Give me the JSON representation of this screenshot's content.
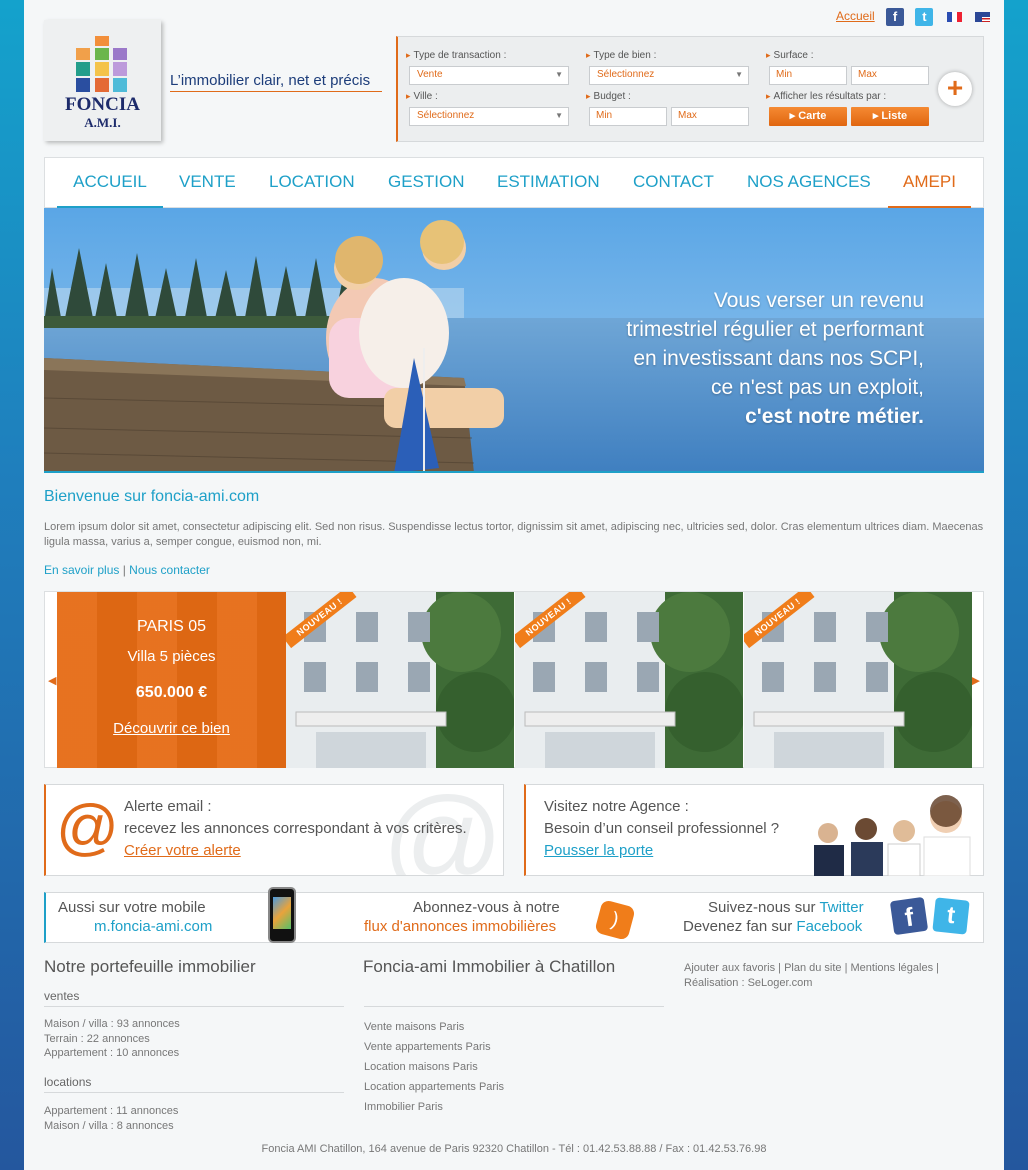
{
  "top": {
    "home_link": "Accueil",
    "fb_letter": "f",
    "tw_letter": "t"
  },
  "logo": {
    "line1": "FONCIA",
    "line2": "A.M.I."
  },
  "tagline": "L’immobilier clair, net et précis",
  "search": {
    "transaction_label": "Type de transaction :",
    "transaction_value": "Vente",
    "bien_label": "Type de bien :",
    "bien_value": "Sélectionnez",
    "surface_label": "Surface :",
    "surface_min": "Min",
    "surface_max": "Max",
    "ville_label": "Ville :",
    "ville_value": "Sélectionnez",
    "budget_label": "Budget :",
    "budget_min": "Min",
    "budget_max": "Max",
    "results_label": "Afficher les résultats par :",
    "carte_btn": "▸ Carte",
    "liste_btn": "▸ Liste",
    "plus": "+"
  },
  "nav": [
    "ACCUEIL",
    "VENTE",
    "LOCATION",
    "GESTION",
    "ESTIMATION",
    "CONTACT",
    "NOS AGENCES",
    "AMEPI"
  ],
  "hero": {
    "l1": "Vous verser un revenu",
    "l2": "trimestriel régulier et performant",
    "l3": "en investissant dans nos SCPI,",
    "l4": "ce n'est pas un exploit,",
    "l5": "c'est notre métier."
  },
  "welcome": {
    "title": "Bienvenue sur foncia-ami.com",
    "text": "Lorem ipsum dolor sit amet, consectetur adipiscing elit. Sed non risus. Suspendisse lectus tortor, dignissim sit amet, adipiscing nec, ultricies sed, dolor. Cras elementum ultrices diam. Maecenas ligula massa, varius a, semper congue, euismod non, mi.",
    "link1": "En savoir plus",
    "sep": " | ",
    "link2": "Nous contacter"
  },
  "featured": {
    "city": "PARIS 05",
    "type": "Villa 5 pièces",
    "price": "650.000 €",
    "cta": "Découvrir ce bien",
    "badge": "NOUVEAU !"
  },
  "alert": {
    "l1": "Alerte email :",
    "l2": "recevez les annonces correspondant à vos critères.",
    "cta": "Créer votre alerte",
    "at": "@"
  },
  "agence": {
    "l1": "Visitez notre Agence :",
    "l2": "Besoin d’un conseil professionnel ?",
    "cta": "Pousser la porte"
  },
  "strip": {
    "mobile1": "Aussi sur votre  mobile",
    "mobile2": "m.foncia-ami.com",
    "flux1": "Abonnez-vous à notre",
    "flux2": "flux d'annonces immobilières",
    "tw_pre": "Suivez-nous sur ",
    "tw_link": "Twitter",
    "fb_pre": "Devenez fan sur ",
    "fb_link": "Facebook"
  },
  "footer": {
    "col1_title": "Notre portefeuille immobilier",
    "ventes": "ventes",
    "v1": "Maison / villa : 93 annonces",
    "v2": "Terrain : 22 annonces",
    "v3": "Appartement : 10 annonces",
    "locations": "locations",
    "lo1": "Appartement : 11 annonces",
    "lo2": "Maison / villa : 8 annonces",
    "col2_title": "Foncia-ami Immobilier à Chatillon",
    "c2_1": "Vente maisons Paris",
    "c2_2": "Vente appartements Paris",
    "c2_3": "Location maisons Paris",
    "c2_4": "Location appartements Paris",
    "c2_5": "Immobilier Paris",
    "col3_1": "Ajouter aux favoris | Plan du site | Mentions légales |",
    "col3_2": "Réalisation : SeLoger.com",
    "address": "Foncia AMI Chatillon, 164 avenue de Paris 92320 Chatillon - Tél : 01.42.53.88.88 / Fax : 01.42.53.76.98"
  },
  "colors": {
    "accent": "#e06b1a",
    "blue": "#1ea0c8"
  }
}
